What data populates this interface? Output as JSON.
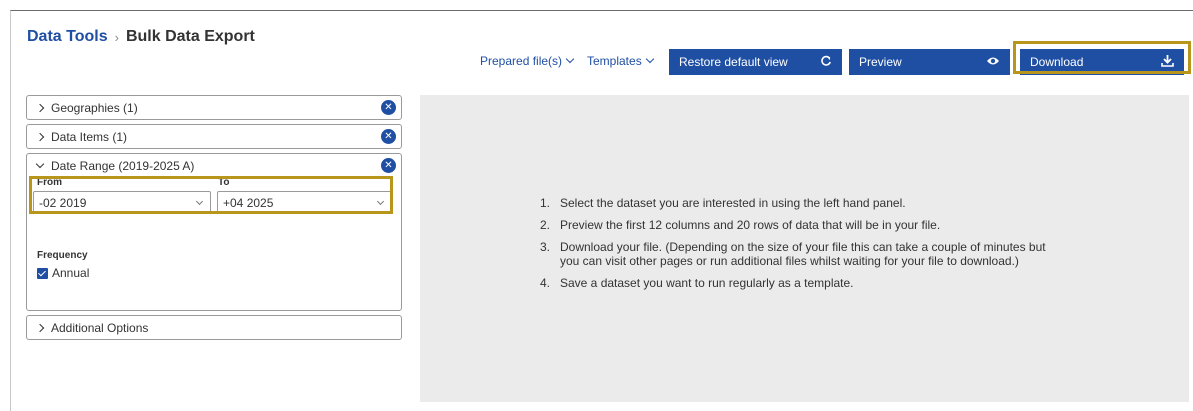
{
  "breadcrumb": {
    "root": "Data Tools",
    "separator": "›",
    "current": "Bulk Data Export"
  },
  "toolbar": {
    "prepared_files": "Prepared file(s)",
    "templates": "Templates",
    "restore_label": "Restore default view",
    "preview_label": "Preview",
    "download_label": "Download"
  },
  "sidebar": {
    "geographies": "Geographies (1)",
    "data_items": "Data Items (1)",
    "date_range": "Date Range (2019-2025 A)",
    "from_label": "From",
    "to_label": "To",
    "from_value": "-02 2019",
    "to_value": "+04 2025",
    "frequency_label": "Frequency",
    "frequency_option": "Annual",
    "additional_options": "Additional Options"
  },
  "instructions": [
    {
      "num": "1.",
      "text": "Select the dataset you are interested in using the left hand panel."
    },
    {
      "num": "2.",
      "text": "Preview the first 12 columns and 20 rows of data that will be in your file."
    },
    {
      "num": "3.",
      "text": "Download your file. (Depending on the size of your file this can take a couple of minutes but\nyou can visit other pages or run additional files whilst waiting for your file to download.)"
    },
    {
      "num": "4.",
      "text": "Save a dataset you want to run regularly as a template."
    }
  ],
  "colors": {
    "primary": "#1f4fa3",
    "highlight": "#b8961c",
    "panel_bg": "#ebebeb"
  },
  "icons": {
    "restore": "refresh-icon",
    "preview": "eye-icon",
    "download": "download-icon",
    "remove": "close-circle-icon"
  }
}
